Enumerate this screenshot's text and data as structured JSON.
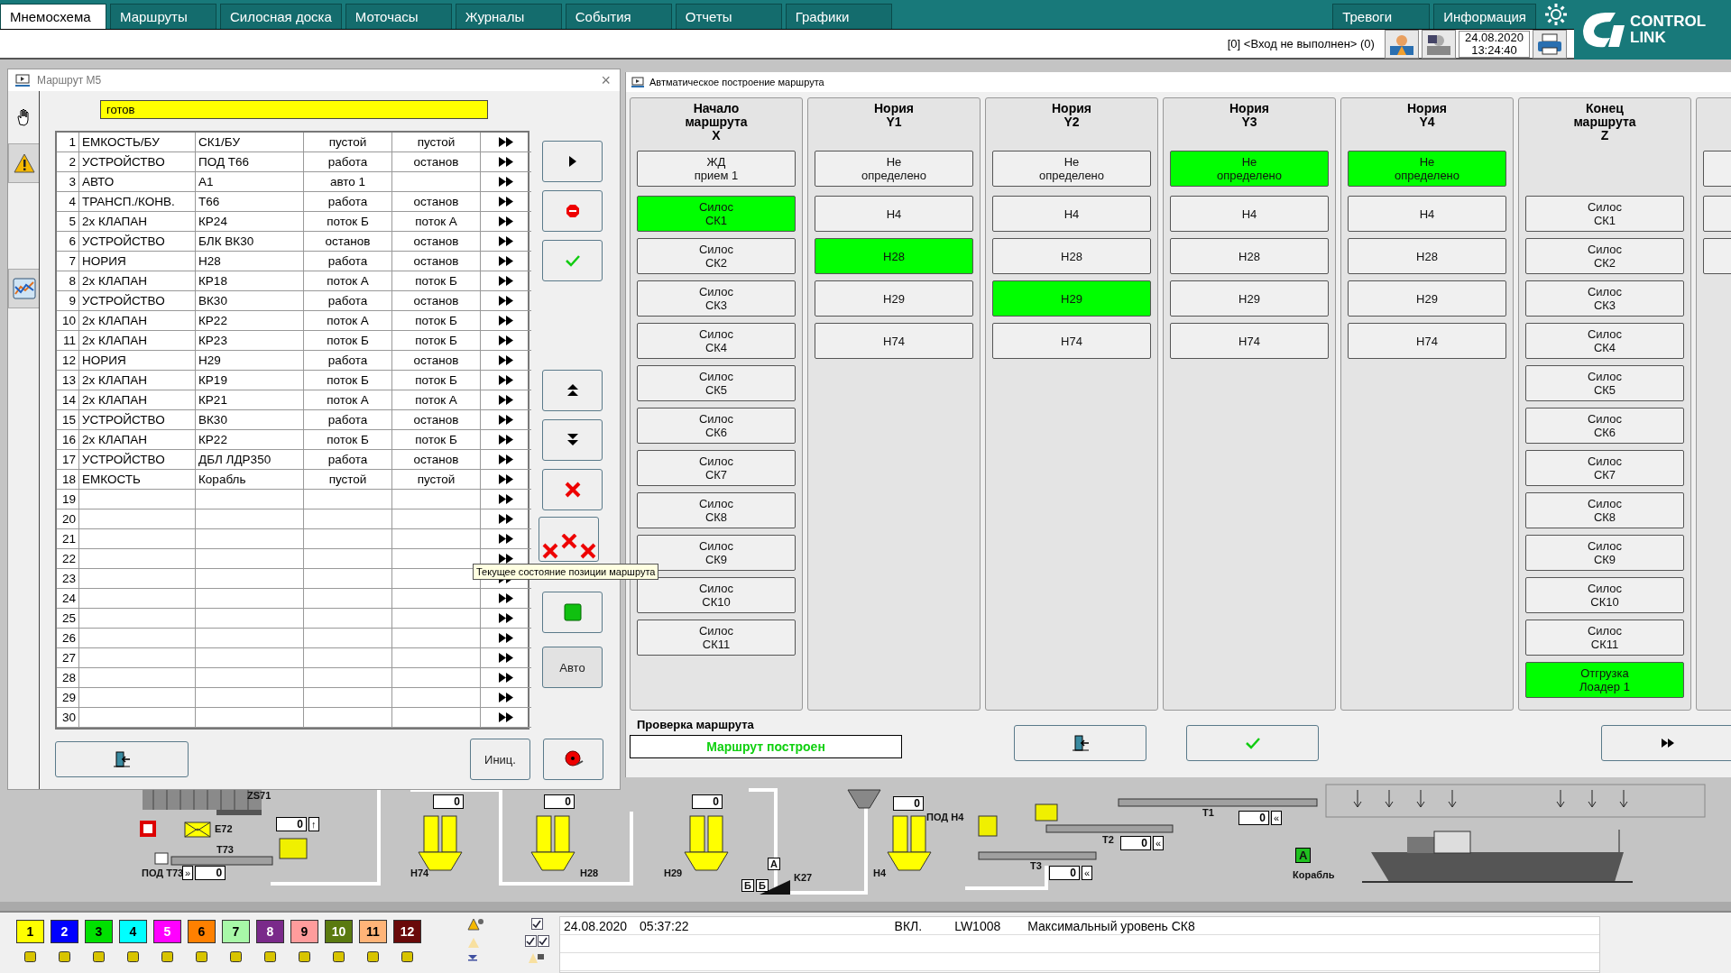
{
  "top_bar": {
    "tabs": [
      {
        "label": "Мнемосхема",
        "selected": true
      },
      {
        "label": "Маршруты",
        "selected": false
      },
      {
        "label": "Силосная доска",
        "selected": false
      },
      {
        "label": "Моточасы",
        "selected": false
      },
      {
        "label": "Журналы",
        "selected": false
      },
      {
        "label": "События",
        "selected": false
      },
      {
        "label": "Отчеты",
        "selected": false
      },
      {
        "label": "Графики",
        "selected": false
      }
    ],
    "right_tabs": [
      {
        "label": "Тревоги",
        "selected": false
      },
      {
        "label": "Информация",
        "selected": false
      }
    ],
    "login": "[0] <Вход не выполнен> (0)",
    "date": "24.08.2020",
    "time": "13:24:40",
    "logo": {
      "line_1": "CONTROL",
      "line_2": "LINK"
    }
  },
  "route_window": {
    "title": "Маршрут М5",
    "close": "×",
    "status": "готов",
    "sidebar_tabs": [
      {
        "kind": "hand"
      },
      {
        "kind": "alarm"
      },
      {
        "kind": "chart"
      }
    ],
    "rows": [
      {
        "column_1": "1",
        "column_2": "ЕМКОСТЬ/БУ",
        "column_3": "СК1/БУ",
        "column_4": "пустой",
        "column_5": "пустой"
      },
      {
        "column_1": "2",
        "column_2": "УСТРОЙСТВО",
        "column_3": "ПОД Т66",
        "column_4": "работа",
        "column_5": "останов"
      },
      {
        "column_1": "3",
        "column_2": "АВТО",
        "column_3": "А1",
        "column_4": "авто 1"
      },
      {
        "column_1": "4",
        "column_2": "ТРАНСП./КОНВ.",
        "column_3": "Т66",
        "column_4": "работа",
        "column_5": "останов"
      },
      {
        "column_1": "5",
        "column_2": "2x КЛАПАН",
        "column_3": "КР24",
        "column_4": "поток Б",
        "column_5": "поток А"
      },
      {
        "column_1": "6",
        "column_2": "УСТРОЙСТВО",
        "column_3": "БЛК ВК30",
        "column_4": "останов",
        "column_5": "останов"
      },
      {
        "column_1": "7",
        "column_2": "НОРИЯ",
        "column_3": "Н28",
        "column_4": "работа",
        "column_5": "останов"
      },
      {
        "column_1": "8",
        "column_2": "2x КЛАПАН",
        "column_3": "КР18",
        "column_4": "поток А",
        "column_5": "поток Б"
      },
      {
        "column_1": "9",
        "column_2": "УСТРОЙСТВО",
        "column_3": "ВК30",
        "column_4": "работа",
        "column_5": "останов"
      },
      {
        "column_1": "10",
        "column_2": "2x КЛАПАН",
        "column_3": "КР22",
        "column_4": "поток А",
        "column_5": "поток Б"
      },
      {
        "column_1": "11",
        "column_2": "2x КЛАПАН",
        "column_3": "КР23",
        "column_4": "поток Б",
        "column_5": "поток Б"
      },
      {
        "column_1": "12",
        "column_2": "НОРИЯ",
        "column_3": "Н29",
        "column_4": "работа",
        "column_5": "останов"
      },
      {
        "column_1": "13",
        "column_2": "2x КЛАПАН",
        "column_3": "КР19",
        "column_4": "поток Б",
        "column_5": "поток Б"
      },
      {
        "column_1": "14",
        "column_2": "2x КЛАПАН",
        "column_3": "КР21",
        "column_4": "поток А",
        "column_5": "поток А"
      },
      {
        "column_1": "15",
        "column_2": "УСТРОЙСТВО",
        "column_3": "ВК30",
        "column_4": "работа",
        "column_5": "останов"
      },
      {
        "column_1": "16",
        "column_2": "2x КЛАПАН",
        "column_3": "КР22",
        "column_4": "поток Б",
        "column_5": "поток Б"
      },
      {
        "column_1": "17",
        "column_2": "УСТРОЙСТВО",
        "column_3": "ДБЛ ЛДР350",
        "column_4": "работа",
        "column_5": "останов"
      },
      {
        "column_1": "18",
        "column_2": "ЕМКОСТЬ",
        "column_3": "Корабль",
        "column_4": "пустой",
        "column_5": "пустой"
      },
      {
        "column_1": "19"
      },
      {
        "column_1": "20"
      },
      {
        "column_1": "21"
      },
      {
        "column_1": "22"
      },
      {
        "column_1": "23"
      },
      {
        "column_1": "24"
      },
      {
        "column_1": "25"
      },
      {
        "column_1": "26"
      },
      {
        "column_1": "27"
      },
      {
        "column_1": "28"
      },
      {
        "column_1": "29"
      },
      {
        "column_1": "30"
      }
    ],
    "side_buttons": [
      {
        "kind": "play"
      },
      {
        "kind": "stop"
      },
      {
        "kind": "confirm"
      },
      {
        "kind": "move_up"
      },
      {
        "kind": "move_down"
      },
      {
        "kind": "delete"
      },
      {
        "kind": "delete_all"
      },
      {
        "kind": "indicator"
      },
      {
        "kind": "text",
        "label": "Авто"
      }
    ],
    "bottom_buttons": [
      {
        "kind": "exit"
      },
      {
        "kind": "text",
        "label": "Иниц."
      },
      {
        "kind": "record"
      }
    ],
    "tooltip": "Текущее состояние позиции маршрута"
  },
  "builder_window": {
    "title": "Автматическое построение маршрута",
    "columns": [
      {
        "header": "Начало\nмаршрута\nX",
        "start": {
          "label": "ЖД\nприем 1",
          "selected": false
        },
        "items": [
          {
            "label": "Силос\nСК1",
            "selected": true
          },
          {
            "label": "Силос\nСК2",
            "selected": false
          },
          {
            "label": "Силос\nСК3",
            "selected": false
          },
          {
            "label": "Силос\nСК4",
            "selected": false
          },
          {
            "label": "Силос\nСК5",
            "selected": false
          },
          {
            "label": "Силос\nСК6",
            "selected": false
          },
          {
            "label": "Силос\nСК7",
            "selected": false
          },
          {
            "label": "Силос\nСК8",
            "selected": false
          },
          {
            "label": "Силос\nСК9",
            "selected": false
          },
          {
            "label": "Силос\nСК10",
            "selected": false
          },
          {
            "label": "Силос\nСК11",
            "selected": false
          }
        ]
      },
      {
        "header": "Нория\nY1",
        "start": {
          "label": "Не\nопределено",
          "selected": false
        },
        "items": [
          {
            "label": "Н4",
            "selected": false
          },
          {
            "label": "Н28",
            "selected": true
          },
          {
            "label": "Н29",
            "selected": false
          },
          {
            "label": "Н74",
            "selected": false
          }
        ]
      },
      {
        "header": "Нория\nY2",
        "start": {
          "label": "Не\nопределено",
          "selected": false
        },
        "items": [
          {
            "label": "Н4",
            "selected": false
          },
          {
            "label": "Н28",
            "selected": false
          },
          {
            "label": "Н29",
            "selected": true
          },
          {
            "label": "Н74",
            "selected": false
          }
        ]
      },
      {
        "header": "Нория\nY3",
        "start": {
          "label": "Не\nопределено",
          "selected": true
        },
        "items": [
          {
            "label": "Н4",
            "selected": false
          },
          {
            "label": "Н28",
            "selected": false
          },
          {
            "label": "Н29",
            "selected": false
          },
          {
            "label": "Н74",
            "selected": false
          }
        ]
      },
      {
        "header": "Нория\nY4",
        "start": {
          "label": "Не\nопределено",
          "selected": true
        },
        "items": [
          {
            "label": "Н4",
            "selected": false
          },
          {
            "label": "Н28",
            "selected": false
          },
          {
            "label": "Н29",
            "selected": false
          },
          {
            "label": "Н74",
            "selected": false
          }
        ]
      },
      {
        "header": "Конец\nмаршрута\nZ",
        "items": [
          {
            "label": "Силос\nСК1",
            "selected": false
          },
          {
            "label": "Силос\nСК2",
            "selected": false
          },
          {
            "label": "Силос\nСК3",
            "selected": false
          },
          {
            "label": "Силос\nСК4",
            "selected": false
          },
          {
            "label": "Силос\nСК5",
            "selected": false
          },
          {
            "label": "Силос\nСК6",
            "selected": false
          },
          {
            "label": "Силос\nСК7",
            "selected": false
          },
          {
            "label": "Силос\nСК8",
            "selected": false
          },
          {
            "label": "Силос\nСК9",
            "selected": false
          },
          {
            "label": "Силос\nСК10",
            "selected": false
          },
          {
            "label": "Силос\nСК11",
            "selected": false
          },
          {
            "label": "Отгрузка\nЛоадер 1",
            "selected": true
          }
        ]
      },
      {
        "start": {
          "selected": false
        },
        "items": [
          {
            "selected": false
          },
          {
            "selected": false
          }
        ]
      }
    ],
    "check_label": "Проверка маршрута",
    "check_result": "Маршрут построен",
    "buttons": [
      {
        "kind": "exit"
      },
      {
        "kind": "confirm"
      },
      {
        "kind": "forward"
      }
    ]
  },
  "diagram": {
    "labels": [
      {
        "text": "ZS71",
        "kind": "text"
      },
      {
        "text": "E72",
        "kind": "text"
      },
      {
        "text": "T73",
        "kind": "text"
      },
      {
        "text": "ПОД T73",
        "kind": "text"
      },
      {
        "text": "H74",
        "kind": "text"
      },
      {
        "text": "H28",
        "kind": "text"
      },
      {
        "text": "H29",
        "kind": "text"
      },
      {
        "text": "K27",
        "kind": "text"
      },
      {
        "text": "А",
        "kind": "box"
      },
      {
        "text": "Б",
        "kind": "box"
      },
      {
        "text": "Б",
        "kind": "box"
      },
      {
        "text": "H4",
        "kind": "text"
      },
      {
        "text": "ПОД H4",
        "kind": "text"
      },
      {
        "text": "T1",
        "kind": "text"
      },
      {
        "text": "T2",
        "kind": "text"
      },
      {
        "text": "T3",
        "kind": "text"
      },
      {
        "text": "A",
        "kind": "indicator"
      },
      {
        "text": "Корабль",
        "kind": "text"
      }
    ],
    "counters": [
      {
        "value": "0",
        "button": "↑"
      },
      {
        "value": "0",
        "button": "»"
      },
      {
        "value": "0"
      },
      {
        "value": "0"
      },
      {
        "value": "0"
      },
      {
        "value": "0"
      },
      {
        "value": "0",
        "button": "«"
      },
      {
        "value": "0",
        "button": "«"
      },
      {
        "value": "0",
        "button": "«"
      }
    ]
  },
  "status": {
    "color_buttons": [
      {
        "label": "1",
        "color": "#ffff00"
      },
      {
        "label": "2",
        "color": "#0000ff"
      },
      {
        "label": "3",
        "color": "#00e000"
      },
      {
        "label": "4",
        "color": "#00ffff"
      },
      {
        "label": "5",
        "color": "#ff00ff"
      },
      {
        "label": "6",
        "color": "#ff8000"
      },
      {
        "label": "7",
        "color": "#a8f8a8"
      },
      {
        "label": "8",
        "color": "#7a2a8a"
      },
      {
        "label": "9",
        "color": "#ff9c9c"
      },
      {
        "label": "10",
        "color": "#5a7a10"
      },
      {
        "label": "11",
        "color": "#ffb478"
      },
      {
        "label": "12",
        "color": "#6a0a0a"
      }
    ],
    "filters": [
      {
        "checked": true
      },
      {
        "checked": true
      },
      {
        "checked": true
      }
    ],
    "events": [
      {
        "date": "24.08.2020",
        "time": "05:37:22",
        "state": "ВКЛ.",
        "code": "LW1008",
        "message": "Максимальный уровень СК8"
      }
    ]
  }
}
